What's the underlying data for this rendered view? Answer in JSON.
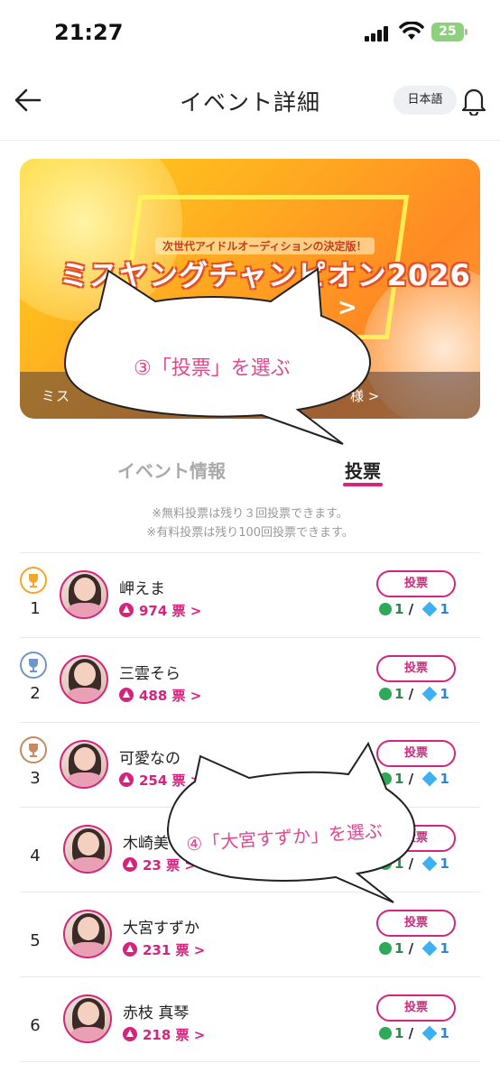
{
  "status": {
    "time": "21:27",
    "battery": "25"
  },
  "header": {
    "title": "イベント詳細",
    "language": "日本語"
  },
  "banner": {
    "tagline": "次世代アイドルオーディションの決定版！",
    "headline": "ミスヤングチャンピオン2026",
    "arrow": ">",
    "bottom_left": "ミス",
    "bottom_right": "様 >"
  },
  "tabs": {
    "info": "イベント情報",
    "vote": "投票"
  },
  "notes": [
    "※無料投票は残り３回投票できます。",
    "※有料投票は残り100回投票できます。"
  ],
  "vote_button_label": "投票",
  "votes_suffix": "票 >",
  "rows": [
    {
      "rank": "1",
      "name": "岬えま",
      "votes": "974",
      "free_cost": "1",
      "paid_cost": "1",
      "badge_color": "#f2a62a"
    },
    {
      "rank": "2",
      "name": "三雲そら",
      "votes": "488",
      "free_cost": "1",
      "paid_cost": "1",
      "badge_color": "#6f96cc"
    },
    {
      "rank": "3",
      "name": "可愛なの",
      "votes": "254",
      "free_cost": "1",
      "paid_cost": "1",
      "badge_color": "#c58a5f"
    },
    {
      "rank": "4",
      "name": "木崎美",
      "votes": "23",
      "free_cost": "1",
      "paid_cost": "1"
    },
    {
      "rank": "5",
      "name": "大宮すずか",
      "votes": "231",
      "free_cost": "1",
      "paid_cost": "1"
    },
    {
      "rank": "6",
      "name": "赤枝 真琴",
      "votes": "218",
      "free_cost": "1",
      "paid_cost": "1"
    }
  ],
  "annotations": {
    "bubble1": "③「投票」を選ぶ",
    "bubble2": "④「大宮すずか」を選ぶ"
  },
  "colors": {
    "accent": "#d6247e",
    "annotation_text": "#e0488e"
  }
}
